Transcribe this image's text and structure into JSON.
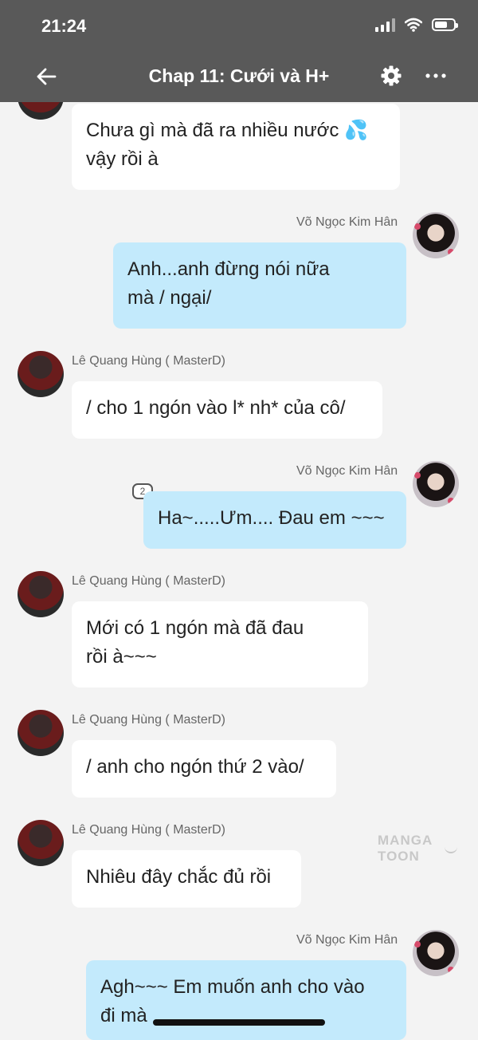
{
  "status_bar": {
    "time": "21:24"
  },
  "header": {
    "title": "Chap 11: Cưới và H+"
  },
  "icons": {
    "back": "arrow-left-icon",
    "settings": "gear-icon",
    "more": "more-horizontal-icon"
  },
  "messages": [
    {
      "side": "left",
      "text": "Chưa gì mà đã ra nhiều nước 💦\nvậy rồi à"
    },
    {
      "side": "right",
      "sender": "Võ Ngọc Kim Hân",
      "text": "Anh...anh đừng nói nữa\nmà / ngại/"
    },
    {
      "side": "left",
      "sender": "Lê Quang Hùng ( MasterD)",
      "text": "/ cho 1 ngón vào l* nh* của cô/"
    },
    {
      "side": "right",
      "sender": "Võ Ngọc Kim Hân",
      "text": "Ha~.....Ưm.... Đau em ~~~",
      "badge": "2"
    },
    {
      "side": "left",
      "sender": "Lê Quang Hùng ( MasterD)",
      "text": "Mới có 1 ngón mà đã đau\nrồi à~~~"
    },
    {
      "side": "left",
      "sender": "Lê Quang Hùng ( MasterD)",
      "text": "/ anh cho ngón thứ 2 vào/"
    },
    {
      "side": "left",
      "sender": "Lê Quang Hùng ( MasterD)",
      "text": "Nhiêu đây chắc đủ rồi"
    },
    {
      "side": "right",
      "sender": "Võ Ngọc Kim Hân",
      "text": "Agh~~~ Em muốn anh cho vào\nđi mà"
    }
  ],
  "watermark": "MANGA TOON",
  "colors": {
    "header_bg": "#595959",
    "page_bg": "#f3f3f3",
    "left_bubble": "#ffffff",
    "right_bubble": "#c3eafc"
  }
}
